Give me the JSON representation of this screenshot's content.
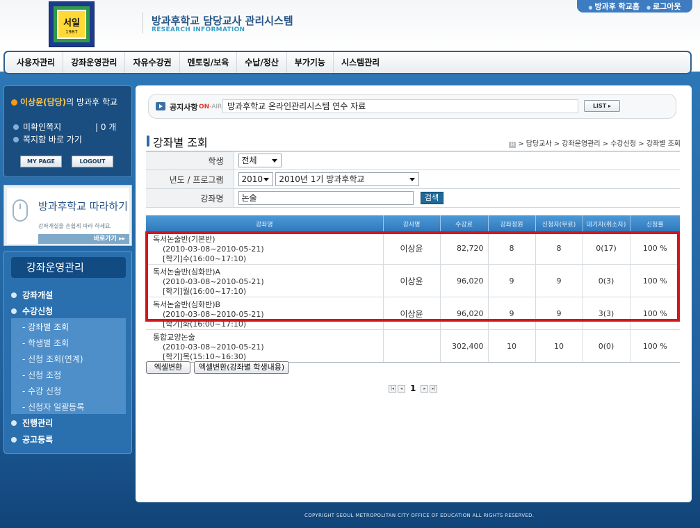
{
  "header": {
    "logo_text": "서일",
    "logo_year": "1987",
    "system_title": "방과후학교 담당교사 관리시스템",
    "system_subtitle": "RESEARCH INFORMATION",
    "util_home": "방과후 학교홈",
    "util_logout": "로그아웃"
  },
  "gnb": {
    "items": [
      "사용자관리",
      "강좌운영관리",
      "자유수강권",
      "멘토링/보육",
      "수납/정산",
      "부가기능",
      "시스템관리"
    ]
  },
  "user_box": {
    "name": "이상윤(담당)",
    "suffix": "의 방과후 학교",
    "unread_label": "미확인쪽지",
    "unread_count": "| 0 개",
    "go_inbox": "쪽지함 바로 가기",
    "mypage": "MY PAGE",
    "logout": "LOGOUT"
  },
  "banner": {
    "title": "방과후학교 따라하기",
    "subtitle": "강좌개설을 손쉽게 따라 하세요.",
    "go": "바로가기 ▸▸"
  },
  "lnb": {
    "title": "강좌운영관리",
    "items": [
      "강좌개설",
      "수강신청",
      "진행관리",
      "공고등록"
    ],
    "sub_items": [
      "- 강좌별 조회",
      "- 학생별 조회",
      "- 신청 조회(연계)",
      "- 신청 조정",
      "- 수강 신청",
      "- 신청자 일괄등록"
    ]
  },
  "notice": {
    "label": "공지사항",
    "onair_a": "ON",
    "onair_b": "-AIR",
    "text": "방과후학교 온라인관리시스템 연수 자료",
    "list_button": "LIST ▸"
  },
  "page": {
    "title": "강좌별 조회",
    "breadcrumb_icon": "H",
    "breadcrumb": "> 담당교사 > 강좌운영관리 > 수강신청 > 강좌별 조회"
  },
  "search": {
    "student_label": "학생",
    "student_value": "전체",
    "year_label": "년도 / 프로그램",
    "year_value": "2010",
    "program_value": "2010년 1기 방과후학교",
    "course_label": "강좌명",
    "course_value": "논술",
    "search_button": "검색"
  },
  "table": {
    "headers": [
      "강좌명",
      "강사명",
      "수강료",
      "강좌정원",
      "신청자(무료)",
      "대기자(취소자)",
      "신청률"
    ],
    "rows": [
      {
        "name": "독서논술반(기본반)",
        "period": "(2010-03-08~2010-05-21)",
        "schedule": "[학기]수(16:00~17:10)",
        "teacher": "이상윤",
        "fee": "82,720",
        "capacity": "8",
        "applicants": "8",
        "waiting": "0(17)",
        "rate": "100 %"
      },
      {
        "name": "독서논술반(심화반)A",
        "period": "(2010-03-08~2010-05-21)",
        "schedule": "[학기]월(16:00~17:10)",
        "teacher": "이상윤",
        "fee": "96,020",
        "capacity": "9",
        "applicants": "9",
        "waiting": "0(3)",
        "rate": "100 %"
      },
      {
        "name": "독서논술반(심화반)B",
        "period": "(2010-03-08~2010-05-21)",
        "schedule": "[학기]화(16:00~17:10)",
        "teacher": "이상윤",
        "fee": "96,020",
        "capacity": "9",
        "applicants": "9",
        "waiting": "3(3)",
        "rate": "100 %"
      },
      {
        "name": "통합교양논술",
        "period": "(2010-03-08~2010-05-21)",
        "schedule": "[학기]목(15:10~16:30)",
        "teacher": "",
        "fee": "302,400",
        "capacity": "10",
        "applicants": "10",
        "waiting": "0(0)",
        "rate": "100 %"
      }
    ]
  },
  "actions": {
    "excel": "엑셀변환",
    "excel_students": "엑셀변환(강좌별 학생내용)"
  },
  "pager": {
    "current": "1",
    "first": "|◂",
    "prev": "◂",
    "next": "▸",
    "last": "▸|"
  },
  "footer": {
    "copyright": "COPYRIGHT SEOUL METROPOLITAN CITY OFFICE OF EDUCATION ALL RIGHTS RESERVED."
  }
}
